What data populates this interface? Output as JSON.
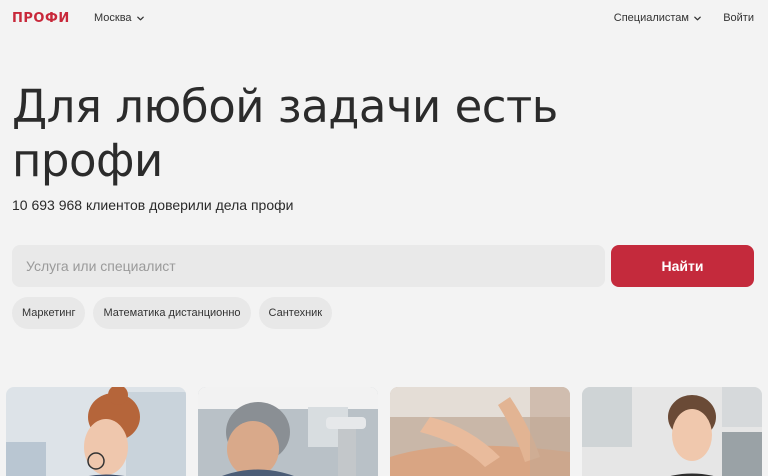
{
  "header": {
    "logo": "ПРОФИ",
    "city": "Москва",
    "specialists": "Специалистам",
    "login": "Войти"
  },
  "hero": {
    "title": "Для любой задачи есть профи",
    "clients_text": "10 693 968 клиентов доверили дела профи"
  },
  "search": {
    "placeholder": "Услуга или специалист",
    "value": "",
    "button_label": "Найти"
  },
  "chips": [
    "Маркетинг",
    "Математика дистанционно",
    "Сантехник"
  ],
  "cards": [
    {
      "subject": "woman with glasses and red hair"
    },
    {
      "subject": "plumber fixing sink"
    },
    {
      "subject": "massage"
    },
    {
      "subject": "woman in kitchen"
    }
  ],
  "colors": {
    "brand": "#c8283a",
    "button": "#c42a3c",
    "background": "#f3f3f3",
    "input_bg": "#e9e9e9"
  },
  "icons": {
    "city_dropdown": "chevron-down-icon",
    "specialists_dropdown": "chevron-down-icon"
  }
}
